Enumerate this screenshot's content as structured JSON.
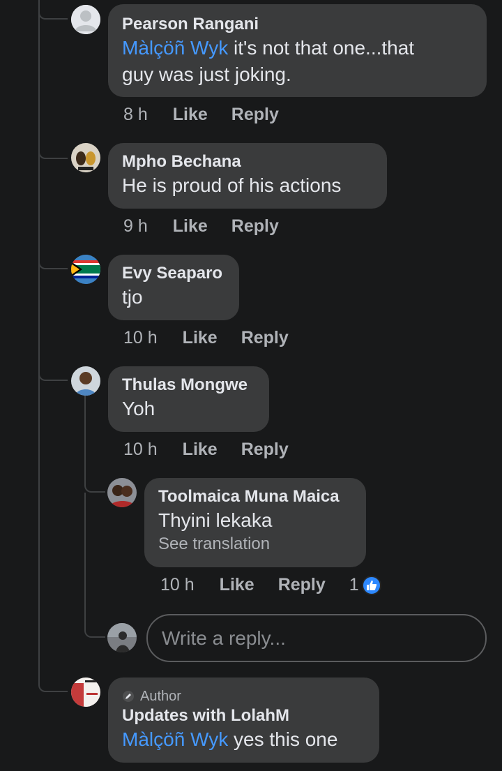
{
  "comments": [
    {
      "name": "Pearson Rangani",
      "mention": "Màlçöñ Wyk",
      "text_line1": " it's not that one...that",
      "text_line2": "guy was just joking.",
      "time": "8 h",
      "like": "Like",
      "reply": "Reply"
    },
    {
      "name": "Mpho Bechana",
      "text": "He is proud of his actions",
      "time": "9 h",
      "like": "Like",
      "reply": "Reply"
    },
    {
      "name": "Evy Seaparo",
      "text": "tjo",
      "time": "10 h",
      "like": "Like",
      "reply": "Reply"
    },
    {
      "name": "Thulas Mongwe",
      "text": "Yoh",
      "time": "10 h",
      "like": "Like",
      "reply": "Reply",
      "replies": [
        {
          "name": "Toolmaica Muna Maica",
          "text": "Thyini lekaka",
          "see_translation": "See translation",
          "time": "10 h",
          "like": "Like",
          "reply": "Reply",
          "reaction_count": "1",
          "reaction_icon": "like-icon"
        }
      ],
      "reply_input_placeholder": "Write a reply..."
    },
    {
      "author_badge": "Author",
      "name": "Updates with LolahM",
      "mention": "Màlçöñ Wyk",
      "text": " yes this one"
    }
  ],
  "colors": {
    "background": "#18191a",
    "bubble": "#3a3b3c",
    "mention": "#4599ff",
    "like_blue": "#2d88ff"
  }
}
